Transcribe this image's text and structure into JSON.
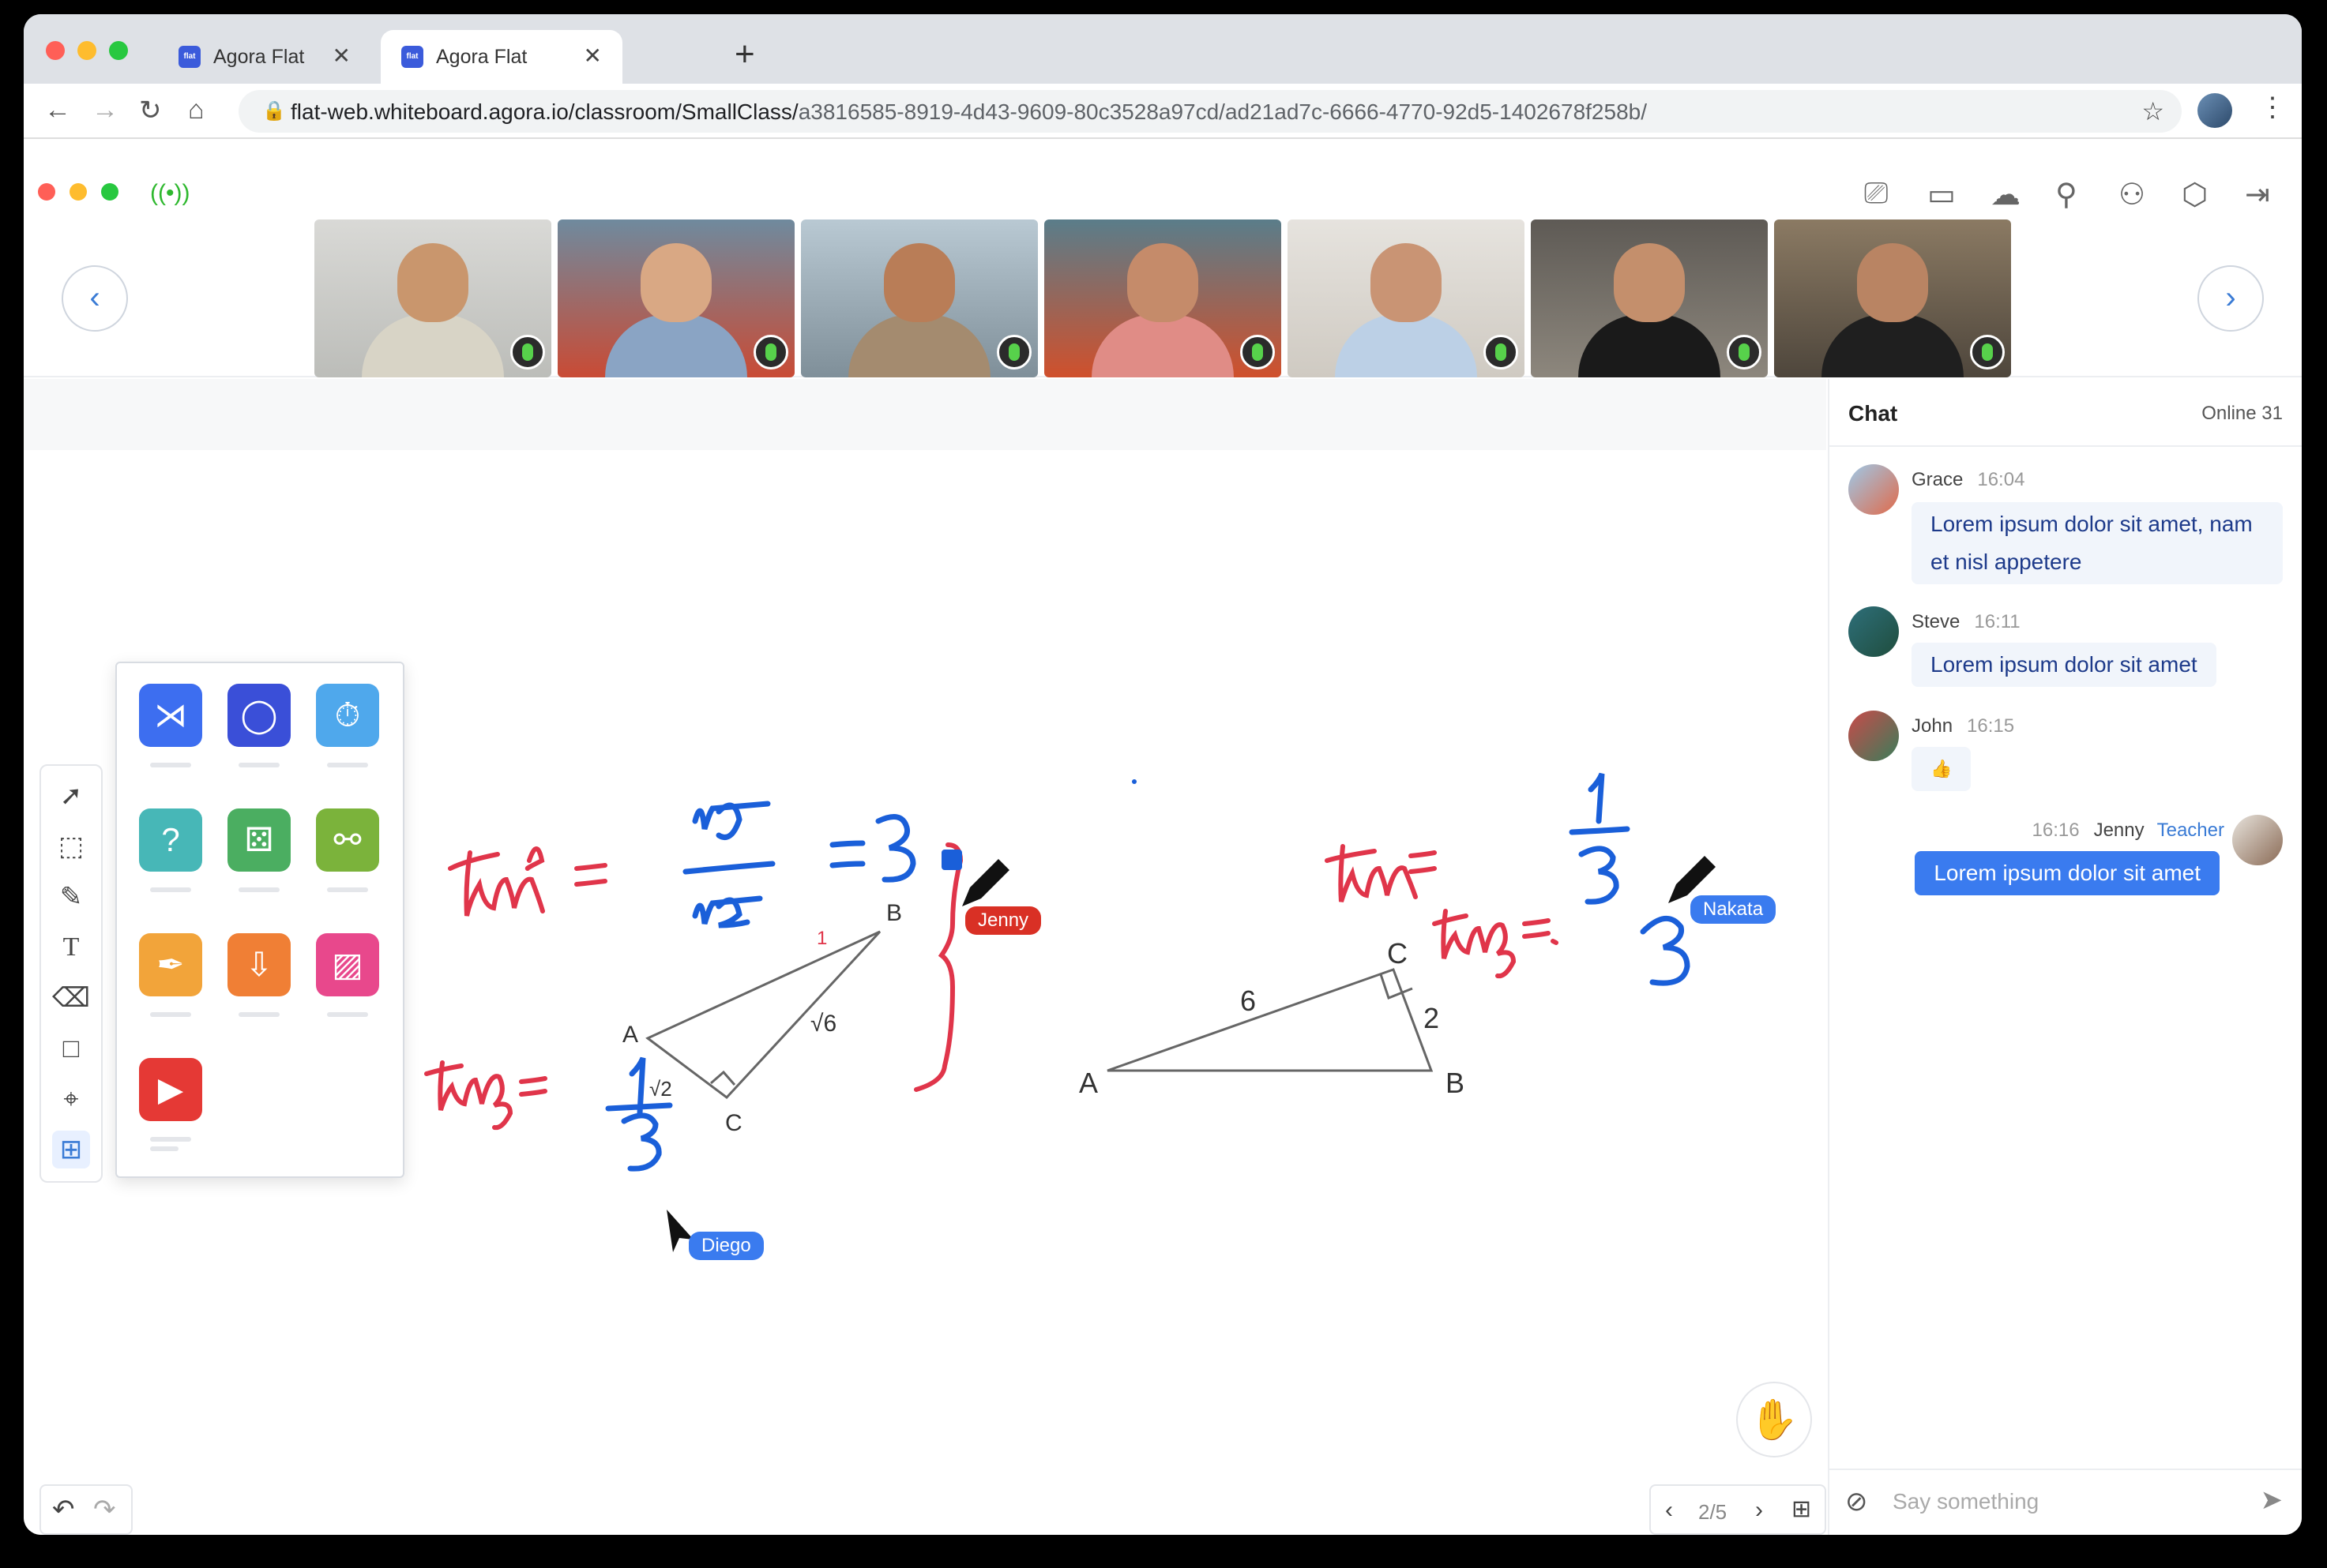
{
  "browser": {
    "tabs": [
      {
        "title": "Agora Flat"
      },
      {
        "title": "Agora Flat"
      }
    ],
    "url_host": "flat-web.whiteboard.agora.io/classroom/SmallClass/",
    "url_path": "a3816585-8919-4d43-9609-80c3528a97cd/ad21ad7c-6666-4770-92d5-1402678f258b/"
  },
  "participants": [
    {
      "name": "video-1",
      "shirt": "#d8d4c6"
    },
    {
      "name": "video-2",
      "shirt": "#8aa4c4"
    },
    {
      "name": "video-3",
      "shirt": "#a48b6f"
    },
    {
      "name": "video-4",
      "shirt": "#e08c86"
    },
    {
      "name": "video-5",
      "shirt": "#bcd0e6"
    },
    {
      "name": "video-6",
      "shirt": "#1a1a1a"
    },
    {
      "name": "video-7",
      "shirt": "#1f1f1f"
    }
  ],
  "whiteboard": {
    "cursors": [
      {
        "label": "Jenny",
        "color": "#d93025"
      },
      {
        "label": "Nakata",
        "color": "#3a7bef"
      },
      {
        "label": "Diego",
        "color": "#3a7bef"
      }
    ],
    "triangle1": {
      "A": "A",
      "B": "B",
      "C": "C",
      "side": "√6",
      "small": "√2",
      "top": "1"
    },
    "triangle2": {
      "A": "A",
      "B": "B",
      "C": "C",
      "s1": "6",
      "s2": "2"
    },
    "pager": "2/5"
  },
  "chat": {
    "title": "Chat",
    "online": "Online 31",
    "messages": [
      {
        "name": "Grace",
        "time": "16:04",
        "text": "Lorem ipsum dolor sit amet, nam et nisl appetere",
        "text_line2": ""
      },
      {
        "name": "Steve",
        "time": "16:11",
        "text": "Lorem ipsum dolor sit amet"
      },
      {
        "name": "John",
        "time": "16:15",
        "text": "👍"
      },
      {
        "name": "Jenny",
        "time": "16:16",
        "role": "Teacher",
        "text": "Lorem ipsum dolor sit amet"
      }
    ],
    "input_placeholder": "Say something"
  }
}
